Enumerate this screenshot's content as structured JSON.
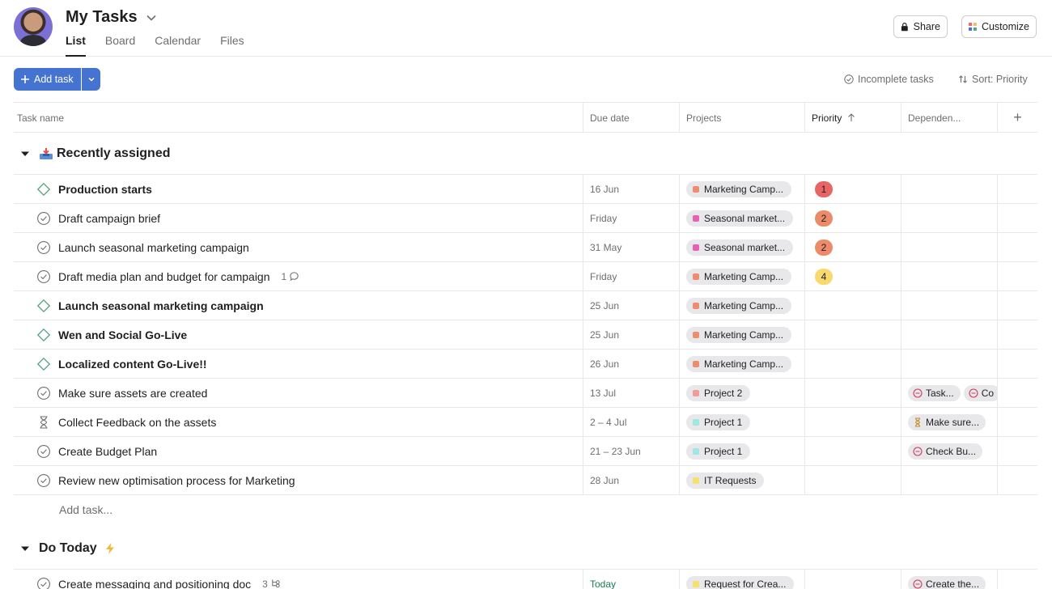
{
  "header": {
    "title": "My Tasks",
    "tabs": [
      "List",
      "Board",
      "Calendar",
      "Files"
    ],
    "share_label": "Share",
    "customize_label": "Customize"
  },
  "toolbar": {
    "add_task_label": "Add task",
    "filter_label": "Incomplete tasks",
    "sort_label": "Sort: Priority"
  },
  "columns": [
    "Task name",
    "Due date",
    "Projects",
    "Priority",
    "Dependen...",
    "+"
  ],
  "colors": {
    "accent": "#4573d2",
    "priority_1": "#e86565",
    "priority_2": "#ec8b6a",
    "priority_4": "#f7d96e",
    "project_marketing": "#ec8d71",
    "project_seasonal": "#e362b4",
    "project_2": "#f09a9a",
    "project_1": "#9ee7e3",
    "project_it": "#f8df72",
    "project_request": "#f8df72"
  },
  "sections": [
    {
      "title": "Recently assigned",
      "icon": "inbox-tray-icon",
      "rows": [
        {
          "name": "Production starts",
          "icon": "milestone-icon",
          "bold": true,
          "due": "16 Jun",
          "project": "Marketing Camp...",
          "project_color": "#ec8d71",
          "priority": "1",
          "priority_color": "#e86565",
          "deps": [],
          "meta": ""
        },
        {
          "name": "Draft campaign brief",
          "icon": "check-circle-icon",
          "bold": false,
          "due": "Friday",
          "project": "Seasonal market...",
          "project_color": "#e362b4",
          "priority": "2",
          "priority_color": "#ec8b6a",
          "deps": [],
          "meta": ""
        },
        {
          "name": "Launch seasonal marketing campaign",
          "icon": "check-circle-icon",
          "bold": false,
          "due": "31 May",
          "project": "Seasonal market...",
          "project_color": "#e362b4",
          "priority": "2",
          "priority_color": "#ec8b6a",
          "deps": [],
          "meta": ""
        },
        {
          "name": "Draft media plan and budget for campaign",
          "icon": "check-circle-icon",
          "bold": false,
          "due": "Friday",
          "project": "Marketing Camp...",
          "project_color": "#ec8d71",
          "priority": "4",
          "priority_color": "#f7d96e",
          "deps": [],
          "meta": "1",
          "meta_icon": "comment-icon"
        },
        {
          "name": "Launch seasonal marketing campaign",
          "icon": "milestone-icon",
          "bold": true,
          "due": "25 Jun",
          "project": "Marketing Camp...",
          "project_color": "#ec8d71",
          "priority": "",
          "priority_color": "",
          "deps": [],
          "meta": ""
        },
        {
          "name": "Wen and Social Go-Live",
          "icon": "milestone-icon",
          "bold": true,
          "due": "25 Jun",
          "project": "Marketing Camp...",
          "project_color": "#ec8d71",
          "priority": "",
          "priority_color": "",
          "deps": [],
          "meta": ""
        },
        {
          "name": "Localized content Go-Live!!",
          "icon": "milestone-icon",
          "bold": true,
          "due": "26 Jun",
          "project": "Marketing Camp...",
          "project_color": "#ec8d71",
          "priority": "",
          "priority_color": "",
          "deps": [],
          "meta": ""
        },
        {
          "name": "Make sure assets are created",
          "icon": "check-circle-icon",
          "bold": false,
          "due": "13 Jul",
          "project": "Project 2",
          "project_color": "#f09a9a",
          "priority": "",
          "priority_color": "",
          "deps": [
            {
              "label": "Task...",
              "icon": "blocked-icon"
            },
            {
              "label": "Co",
              "icon": "blocked-icon"
            }
          ],
          "meta": ""
        },
        {
          "name": "Collect Feedback on the assets",
          "icon": "hourglass-icon",
          "bold": false,
          "due": "2 – 4 Jul",
          "project": "Project 1",
          "project_color": "#9ee7e3",
          "priority": "",
          "priority_color": "",
          "deps": [
            {
              "label": "Make sure...",
              "icon": "hourglass-icon"
            }
          ],
          "meta": ""
        },
        {
          "name": "Create Budget Plan",
          "icon": "check-circle-icon",
          "bold": false,
          "due": "21 – 23 Jun",
          "project": "Project 1",
          "project_color": "#9ee7e3",
          "priority": "",
          "priority_color": "",
          "deps": [
            {
              "label": "Check Bu...",
              "icon": "blocked-icon"
            }
          ],
          "meta": ""
        },
        {
          "name": "Review new optimisation process for Marketing",
          "icon": "check-circle-icon",
          "bold": false,
          "due": "28 Jun",
          "project": "IT Requests",
          "project_color": "#f8df72",
          "priority": "",
          "priority_color": "",
          "deps": [],
          "meta": ""
        }
      ],
      "add_task_label": "Add task..."
    },
    {
      "title": "Do Today",
      "icon": "lightning-icon",
      "rows": [
        {
          "name": "Create messaging and positioning doc",
          "icon": "check-circle-icon",
          "bold": false,
          "due": "Today",
          "due_today": true,
          "project": "Request for Crea...",
          "project_color": "#f8df72",
          "priority": "",
          "priority_color": "",
          "deps": [
            {
              "label": "Create the...",
              "icon": "blocked-icon"
            }
          ],
          "meta": "3",
          "meta_icon": "subtask-icon"
        }
      ]
    }
  ]
}
